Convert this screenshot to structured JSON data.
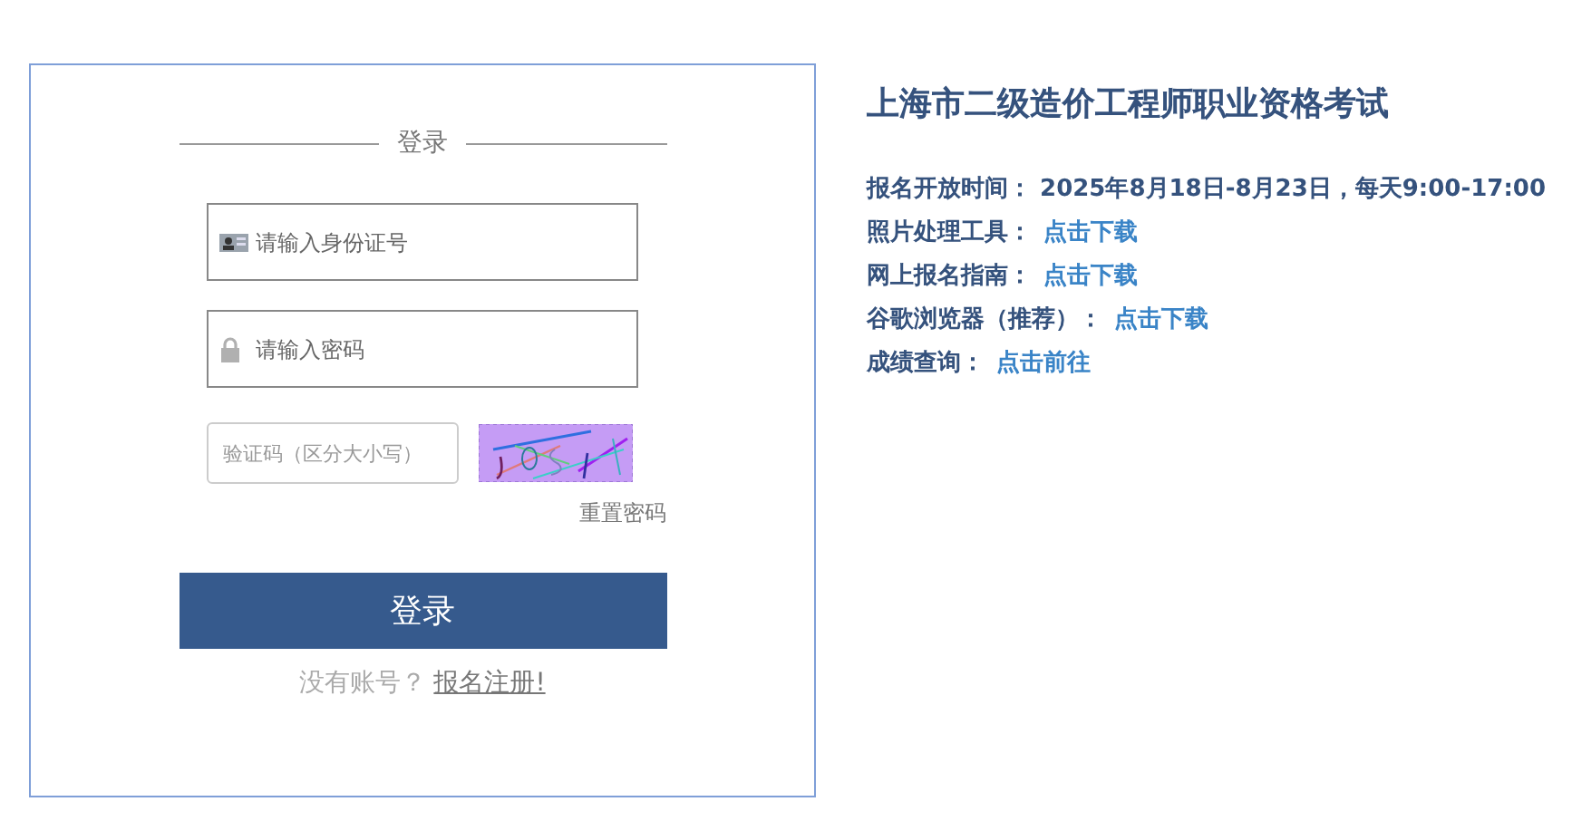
{
  "login": {
    "heading": "登录",
    "id_field": {
      "placeholder": "请输入身份证号"
    },
    "password_field": {
      "placeholder": "请输入密码"
    },
    "captcha_field": {
      "placeholder": "验证码（区分大小写）"
    },
    "reset_link": "重置密码",
    "submit": "登录",
    "register_prompt": "没有账号？",
    "register_link": "报名注册!"
  },
  "info": {
    "title": "上海市二级造价工程师职业资格考试",
    "lines": [
      {
        "label": "报名开放时间：",
        "value": "2025年8月18日-8月23日，每天9:00-17:00",
        "kind": "text"
      },
      {
        "label": "照片处理工具：",
        "value": "点击下载",
        "kind": "link"
      },
      {
        "label": "网上报名指南：",
        "value": "点击下载",
        "kind": "link"
      },
      {
        "label": "谷歌浏览器（推荐）：",
        "value": "点击下载",
        "kind": "link"
      },
      {
        "label": "成绩查询：",
        "value": "点击前往",
        "kind": "link"
      }
    ]
  }
}
